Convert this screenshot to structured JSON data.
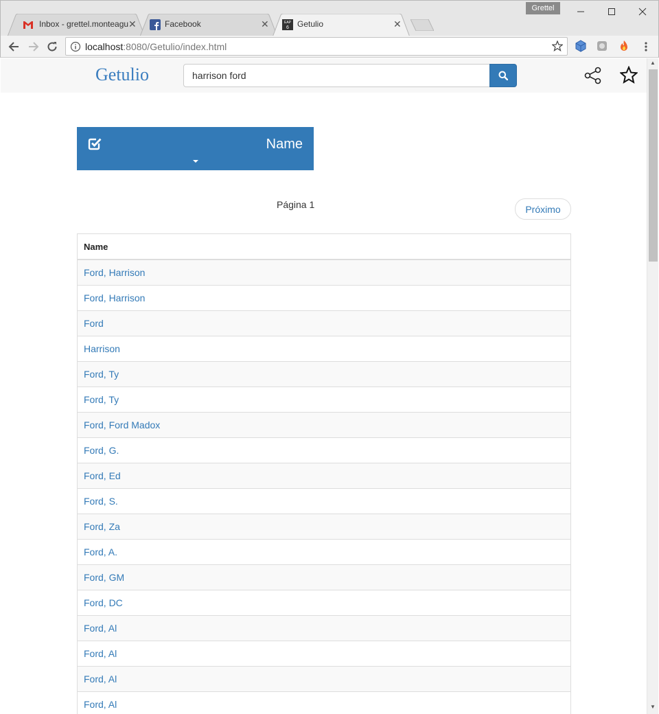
{
  "browser": {
    "profile": "Grettel",
    "tabs": [
      {
        "label": "Inbox - grettel.monteagu",
        "icon": "gmail-icon"
      },
      {
        "label": "Facebook",
        "icon": "facebook-icon"
      },
      {
        "label": "Getulio",
        "icon": "app-icon",
        "icon_text": "6",
        "icon_top": "EAP"
      }
    ],
    "url_host": "localhost",
    "url_rest": ":8080/Getulio/index.html"
  },
  "app": {
    "brand": "Getulio",
    "search_value": "harrison ford"
  },
  "panel": {
    "title": "Name"
  },
  "pagination": {
    "page_label": "Página 1",
    "next_label": "Próximo"
  },
  "table": {
    "header": "Name",
    "rows": [
      "Ford, Harrison",
      "Ford, Harrison",
      "Ford",
      "Harrison",
      "Ford, Ty",
      "Ford, Ty",
      "Ford, Ford Madox",
      "Ford, G.",
      "Ford, Ed",
      "Ford, S.",
      "Ford, Za",
      "Ford, A.",
      "Ford, GM",
      "Ford, DC",
      "Ford, Al",
      "Ford, Al",
      "Ford, Al",
      "Ford, Al"
    ]
  },
  "colors": {
    "primary": "#337ab7",
    "brand": "#3a7dbf"
  }
}
